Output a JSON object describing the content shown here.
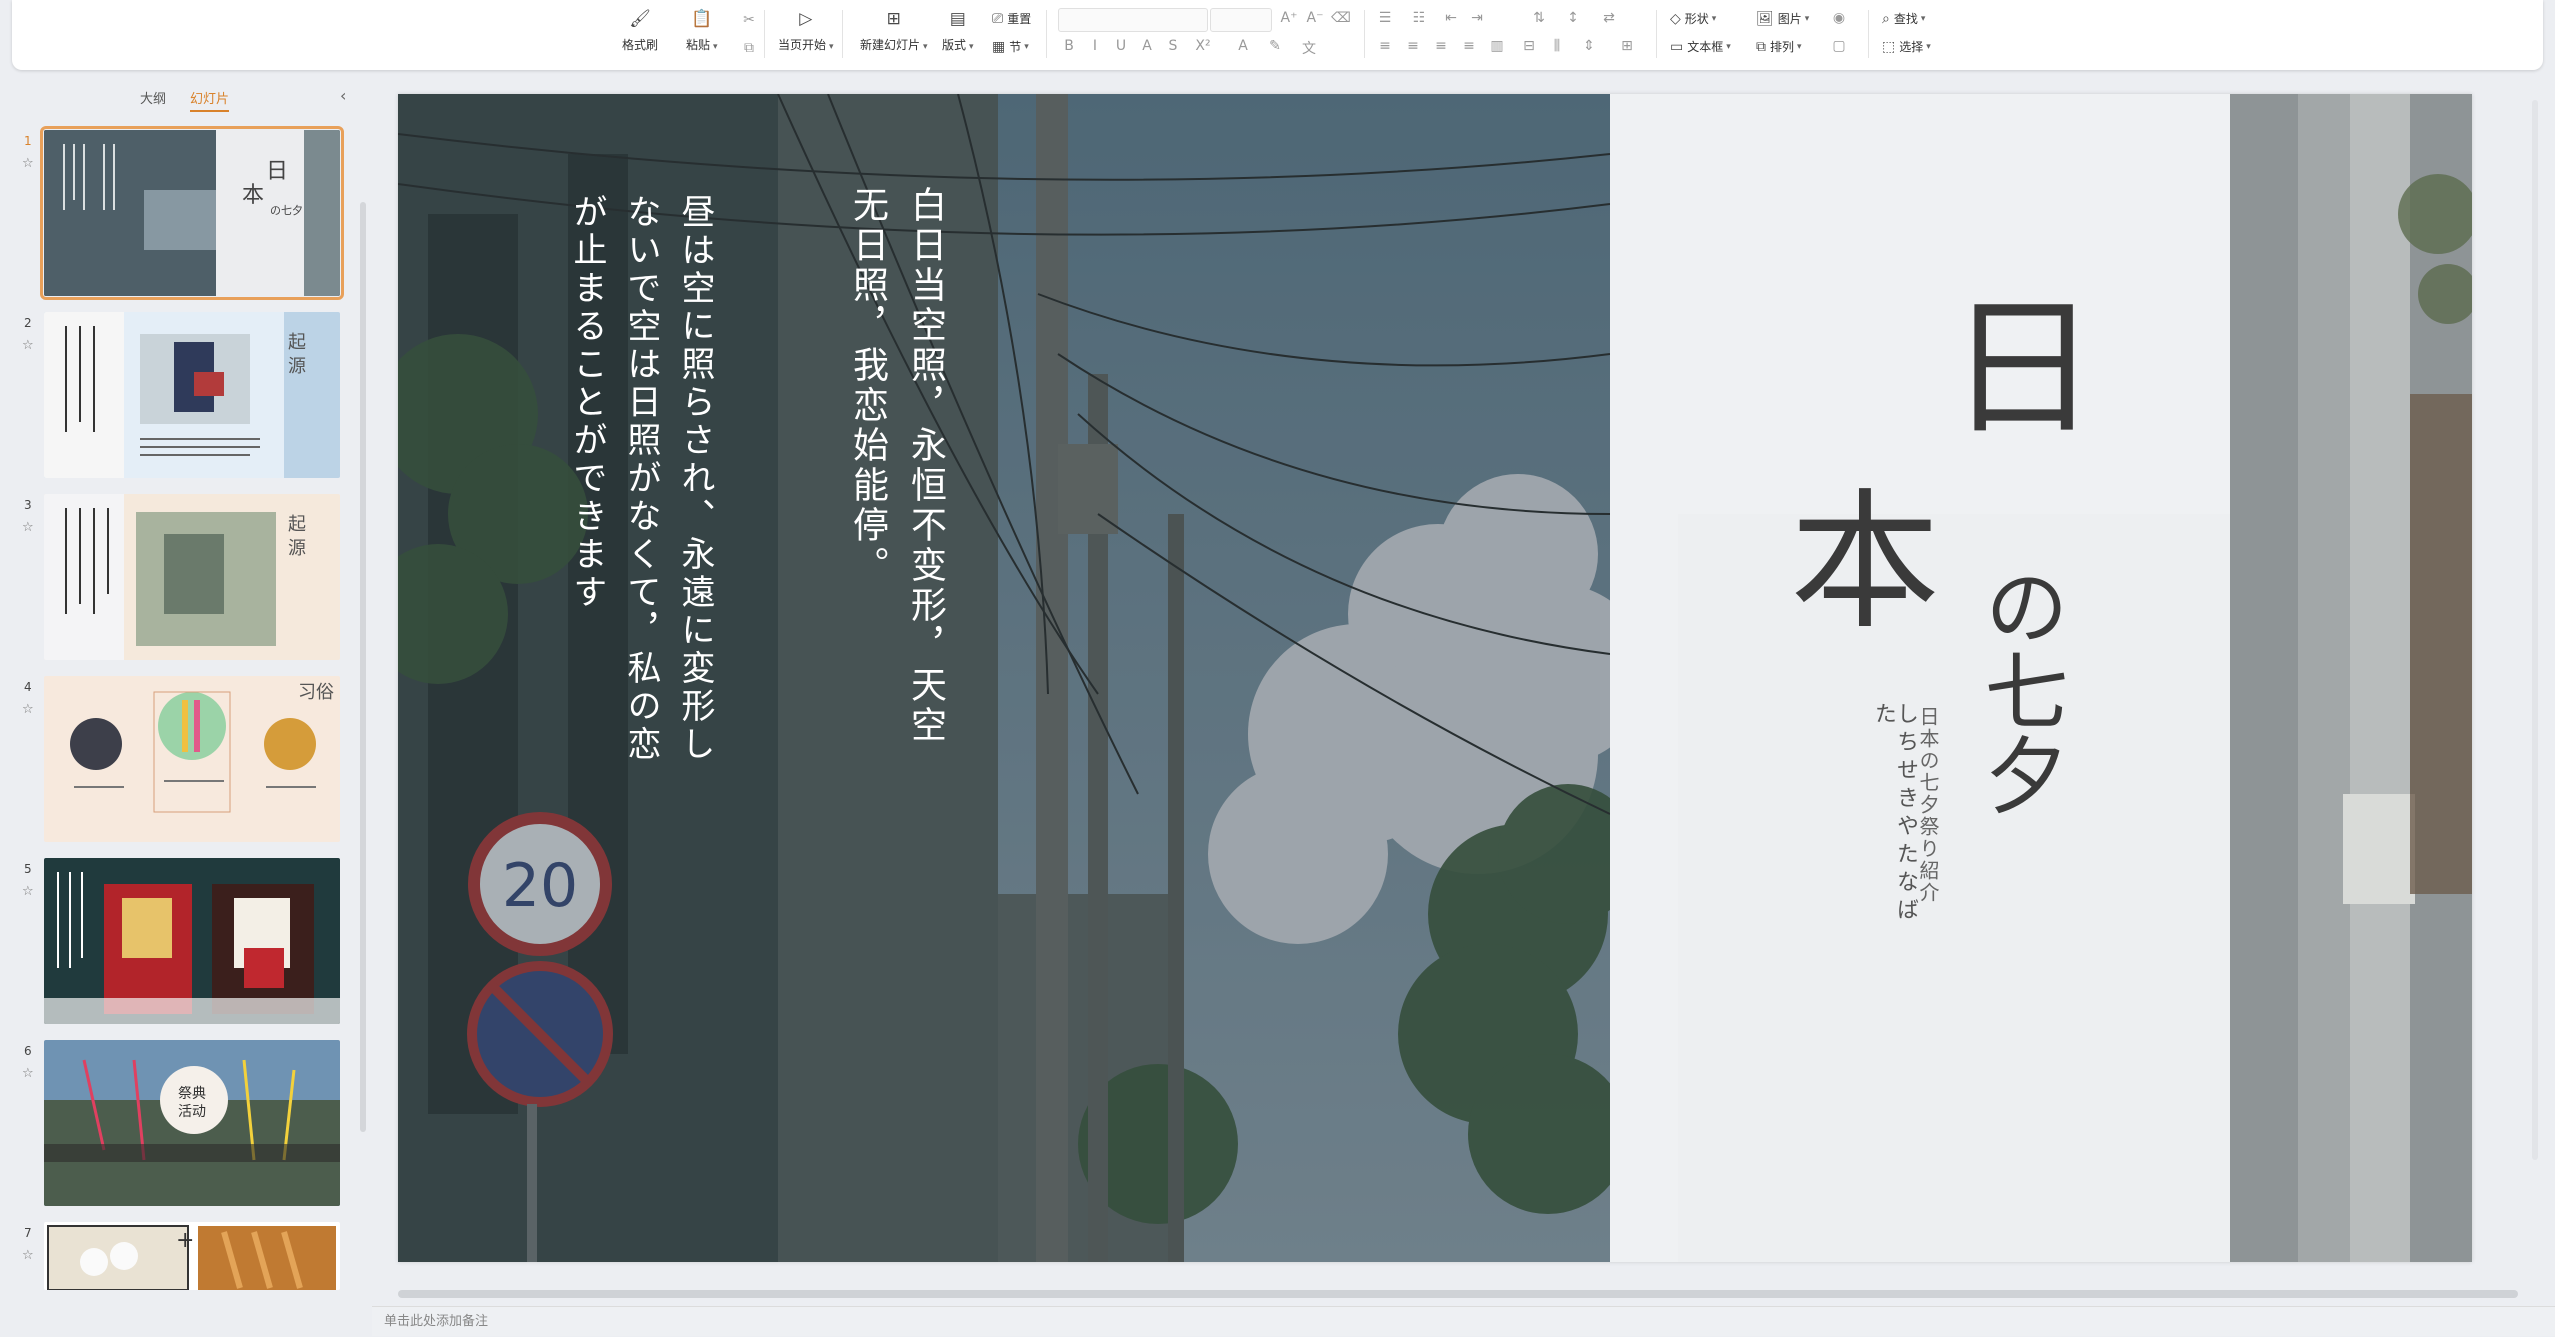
{
  "ribbon": {
    "format_painter": "格式刷",
    "paste": "粘贴",
    "from_current": "当页开始",
    "new_slide": "新建幻灯片",
    "layout": "版式",
    "section": "节",
    "reset": "重置",
    "shape": "形状",
    "picture": "图片",
    "find": "查找",
    "textbox": "文本框",
    "arrange": "排列",
    "select": "选择"
  },
  "left_panel": {
    "tab_outline": "大纲",
    "tab_slides": "幻灯片",
    "add_icon": "+",
    "slides": [
      {
        "number": "1"
      },
      {
        "number": "2"
      },
      {
        "number": "3"
      },
      {
        "number": "4"
      },
      {
        "number": "5"
      },
      {
        "number": "6"
      },
      {
        "number": "7"
      }
    ]
  },
  "slide": {
    "chinese_poem": "白日当空照，永恒不变形，天空无日照，我恋始能停。",
    "japanese_poem": "昼は空に照らされ、永遠に変形しないで空は日照がなくて，私の恋が止まることができます",
    "title_char_1": "日",
    "title_char_2": "本",
    "title_rest": "の七夕",
    "subtitle": "日本の七夕祭り紹介",
    "romaji": "しちせきやたなばた",
    "sign_number": "20"
  },
  "notes": {
    "placeholder": "单击此处添加备注"
  },
  "colors": {
    "accent": "#d9822b",
    "slide_panel": "#f2f3f5"
  }
}
